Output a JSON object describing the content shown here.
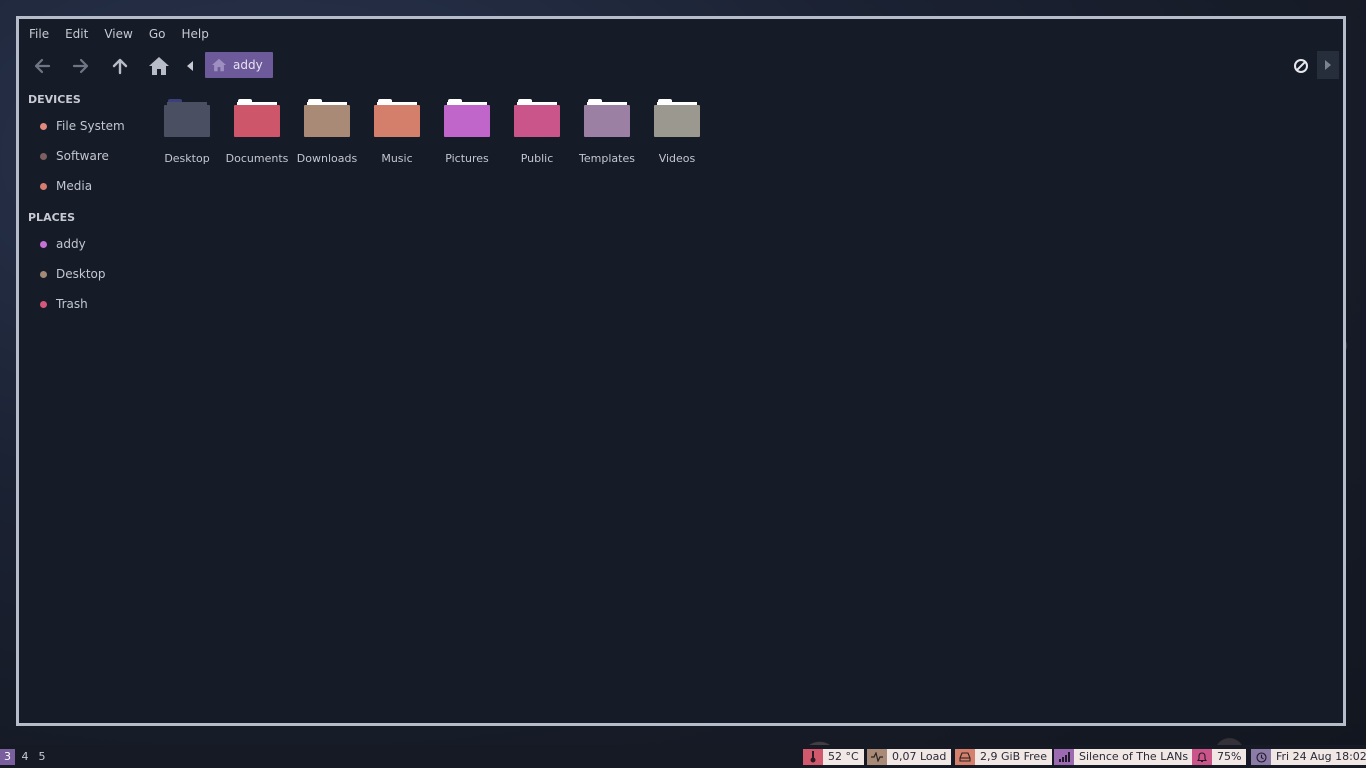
{
  "menu": [
    "File",
    "Edit",
    "View",
    "Go",
    "Help"
  ],
  "breadcrumb": {
    "current": "addy"
  },
  "sidebar": {
    "devices_title": "DEVICES",
    "devices": [
      {
        "label": "File System",
        "color": "#e38a7e"
      },
      {
        "label": "Software",
        "color": "#7d5f5f"
      },
      {
        "label": "Media",
        "color": "#d67d70"
      }
    ],
    "places_title": "PLACES",
    "places": [
      {
        "label": "addy",
        "color": "#c571d6"
      },
      {
        "label": "Desktop",
        "color": "#a38a77"
      },
      {
        "label": "Trash",
        "color": "#d5577a"
      }
    ]
  },
  "folders": [
    {
      "label": "Desktop",
      "color": "#4a5062"
    },
    {
      "label": "Documents",
      "color": "#cd566b"
    },
    {
      "label": "Downloads",
      "color": "#a88a77"
    },
    {
      "label": "Music",
      "color": "#d47f6b"
    },
    {
      "label": "Pictures",
      "color": "#c066cb"
    },
    {
      "label": "Public",
      "color": "#c9558b"
    },
    {
      "label": "Templates",
      "color": "#9c80a3"
    },
    {
      "label": "Videos",
      "color": "#9b988f"
    }
  ],
  "panel": {
    "workspaces": [
      "3",
      "4",
      "5"
    ],
    "temperature": "52 °C",
    "load": "0,07 Load",
    "disk": "2,9 GiB Free",
    "network": "Silence of The LANs",
    "volume": "75%",
    "clock": "Fri 24 Aug 18:02",
    "colors": {
      "temperature": "#d2586e",
      "load": "#a88a77",
      "disk": "#d4806c",
      "network": "#9c6ab0",
      "volume": "#c9558b",
      "clock": "#8c7aa7"
    }
  }
}
